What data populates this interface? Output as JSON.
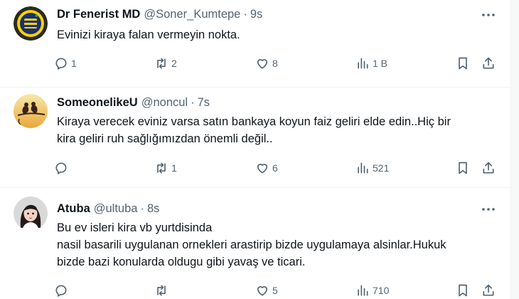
{
  "colors": {
    "text_primary": "#0f1419",
    "text_secondary": "#536471",
    "divider": "#eff3f4"
  },
  "tweets": [
    {
      "display_name": "Dr Fenerist MD",
      "handle": "@Soner_Kumtepe",
      "separator": "·",
      "time": "9s",
      "avatar_icon": "fenerbahce-logo-avatar",
      "lines": [
        "Evinizi kiraya falan vermeyin nokta."
      ],
      "replies": "1",
      "retweets": "2",
      "likes": "8",
      "views": "1 B"
    },
    {
      "display_name": "SomeonelikeU",
      "handle": "@noncul",
      "separator": "·",
      "time": "7s",
      "avatar_icon": "birds-on-branch-avatar",
      "lines": [
        "Kiraya verecek eviniz varsa satın bankaya koyun faiz geliri elde edin..Hiç bir",
        "kira geliri ruh sağlığımızdan önemli değil.."
      ],
      "replies": "",
      "retweets": "1",
      "likes": "6",
      "views": "521"
    },
    {
      "display_name": "Atuba",
      "handle": "@ultuba",
      "separator": "·",
      "time": "8s",
      "avatar_icon": "woman-portrait-avatar",
      "lines": [
        "Bu ev isleri kira vb yurtdisinda",
        "nasil basarili uygulanan ornekleri arastirip  bizde uygulamaya alsinlar.Hukuk",
        "bizde bazi konularda oldugu gibi  yavaş ve ticari."
      ],
      "replies": "",
      "retweets": "",
      "likes": "5",
      "views": "710"
    }
  ]
}
